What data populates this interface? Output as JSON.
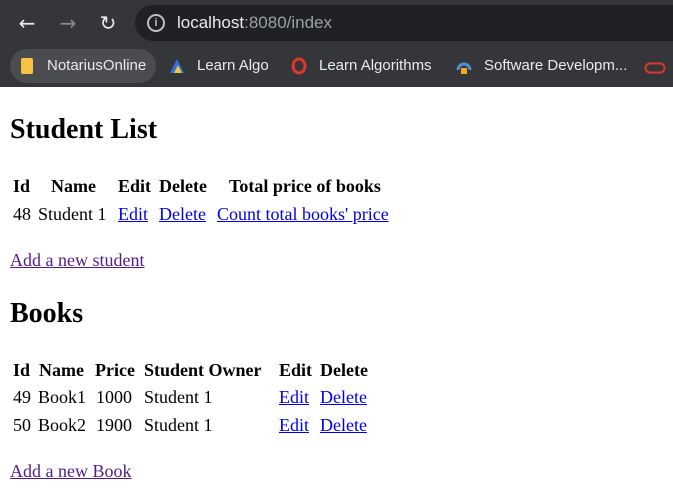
{
  "browser": {
    "url_host": "localhost",
    "url_rest": ":8080/index",
    "bookmarks": [
      {
        "label": "NotariusOnline",
        "icon": "folder-icon"
      },
      {
        "label": "Learn Algo",
        "icon": "learn-algo-icon"
      },
      {
        "label": "Learn Algorithms",
        "icon": "opera-icon"
      },
      {
        "label": "Software Developm...",
        "icon": "software-dev-icon"
      }
    ],
    "colors": {
      "chrome": "#35363a",
      "omnibox": "#202124",
      "link": "#0000ee",
      "visited": "#551a8b"
    }
  },
  "students": {
    "title": "Student List",
    "headers": [
      "Id",
      "Name",
      "Edit",
      "Delete",
      "Total price of books"
    ],
    "rows": [
      {
        "id": "48",
        "name": "Student 1",
        "edit": "Edit",
        "delete": "Delete",
        "count": "Count total books' price"
      }
    ],
    "add_link": "Add a new student"
  },
  "books": {
    "title": "Books",
    "headers": [
      "Id",
      "Name",
      "Price",
      "Student Owner",
      "Edit",
      "Delete"
    ],
    "rows": [
      {
        "id": "49",
        "name": "Book1",
        "price": "1000",
        "owner": "Student 1",
        "edit": "Edit",
        "delete": "Delete"
      },
      {
        "id": "50",
        "name": "Book2",
        "price": "1900",
        "owner": "Student 1",
        "edit": "Edit",
        "delete": "Delete"
      }
    ],
    "add_link": "Add a new Book"
  }
}
